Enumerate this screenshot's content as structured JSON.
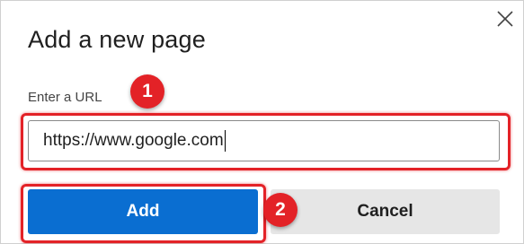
{
  "dialog": {
    "title": "Add a new page",
    "close_icon": "close-icon",
    "url_label": "Enter a URL",
    "url_value": "https://www.google.com",
    "add_label": "Add",
    "cancel_label": "Cancel"
  },
  "annotations": {
    "callout_1": "1",
    "callout_2": "2",
    "highlight_color": "#e32227"
  },
  "colors": {
    "primary_button": "#0a6ed1",
    "secondary_button": "#e6e6e6"
  }
}
